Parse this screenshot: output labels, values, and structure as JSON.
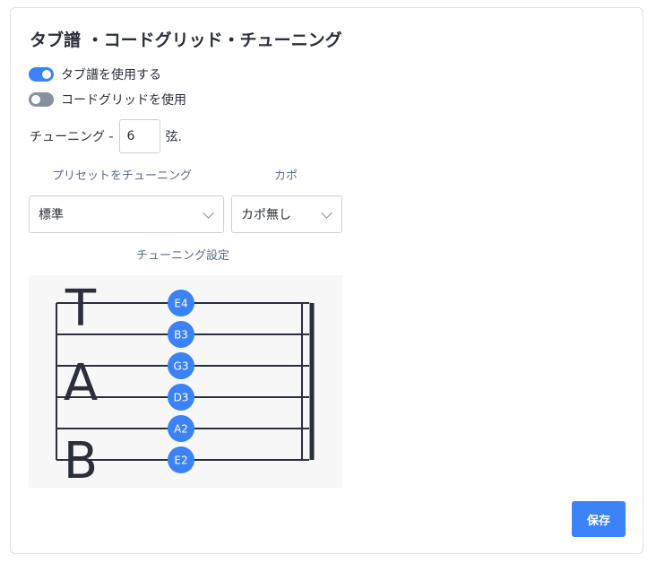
{
  "title": "タブ譜 ・コードグリッド・チューニング",
  "toggles": [
    {
      "label": "タブ譜を使用する",
      "on": true
    },
    {
      "label": "コードグリッドを使用",
      "on": false
    }
  ],
  "strings": {
    "prefix": "チューニング -",
    "value": "6",
    "suffix": "弦."
  },
  "preset": {
    "label": "プリセットをチューニング",
    "selected": "標準"
  },
  "capo": {
    "label": "カポ",
    "selected": "カポ無し"
  },
  "tuning_settings": {
    "label": "チューニング設定",
    "clef": [
      "T",
      "A",
      "B"
    ],
    "notes": [
      "E4",
      "B3",
      "G3",
      "D3",
      "A2",
      "E2"
    ]
  },
  "save_label": "保存",
  "colors": {
    "accent": "#3a82f6",
    "staff": "#2b2f3a"
  }
}
